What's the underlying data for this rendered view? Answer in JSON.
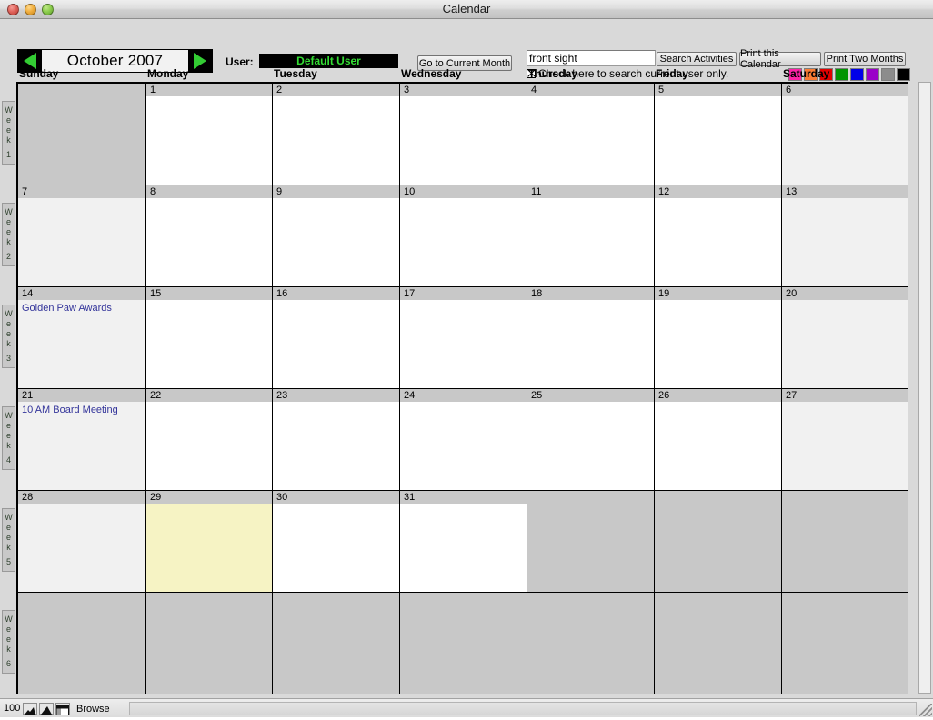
{
  "window": {
    "title": "Calendar",
    "controls": {
      "close": "close-button",
      "minimize": "minimize-button",
      "zoom": "zoom-button"
    }
  },
  "toolbar": {
    "prev_month_icon": "triangle-left-icon",
    "next_month_icon": "triangle-right-icon",
    "month_label": "October 2007",
    "user_label": "User:",
    "user_value": "Default User",
    "goto_current_month": "Go to Current Month",
    "search_value": "front sight",
    "search_placeholder": "",
    "search_activities": "Search Activities",
    "print_this_calendar": "Print this Calendar",
    "print_two_months": "Print Two Months",
    "search_user_only_label": "Check here to search current user only.",
    "search_user_only_checked": true,
    "color_swatches": [
      {
        "name": "magenta",
        "hex": "#ff21a8"
      },
      {
        "name": "orange",
        "hex": "#fa7c34"
      },
      {
        "name": "red",
        "hex": "#e00000"
      },
      {
        "name": "green",
        "hex": "#009400"
      },
      {
        "name": "blue",
        "hex": "#0000e8"
      },
      {
        "name": "purple",
        "hex": "#9a00c8"
      },
      {
        "name": "gray",
        "hex": "#8c8c8c"
      },
      {
        "name": "black",
        "hex": "#000000"
      }
    ]
  },
  "calendar": {
    "day_headers": [
      "Sunday",
      "Monday",
      "Tuesday",
      "Wednesday",
      "Thursday",
      "Friday",
      "Saturday"
    ],
    "week_labels": [
      "Week 1",
      "Week 2",
      "Week 3",
      "Week 4",
      "Week 5",
      "Week 6"
    ],
    "weeks": [
      {
        "label": "Week 1",
        "days": [
          {
            "date": "",
            "blank": true,
            "weekend": true,
            "events": []
          },
          {
            "date": "1",
            "blank": false,
            "weekend": false,
            "events": []
          },
          {
            "date": "2",
            "blank": false,
            "weekend": false,
            "events": []
          },
          {
            "date": "3",
            "blank": false,
            "weekend": false,
            "events": []
          },
          {
            "date": "4",
            "blank": false,
            "weekend": false,
            "events": []
          },
          {
            "date": "5",
            "blank": false,
            "weekend": false,
            "events": []
          },
          {
            "date": "6",
            "blank": false,
            "weekend": true,
            "events": []
          }
        ]
      },
      {
        "label": "Week 2",
        "days": [
          {
            "date": "7",
            "blank": false,
            "weekend": true,
            "events": []
          },
          {
            "date": "8",
            "blank": false,
            "weekend": false,
            "events": []
          },
          {
            "date": "9",
            "blank": false,
            "weekend": false,
            "events": []
          },
          {
            "date": "10",
            "blank": false,
            "weekend": false,
            "events": []
          },
          {
            "date": "11",
            "blank": false,
            "weekend": false,
            "events": []
          },
          {
            "date": "12",
            "blank": false,
            "weekend": false,
            "events": []
          },
          {
            "date": "13",
            "blank": false,
            "weekend": true,
            "events": []
          }
        ]
      },
      {
        "label": "Week 3",
        "days": [
          {
            "date": "14",
            "blank": false,
            "weekend": true,
            "events": [
              "Golden Paw Awards"
            ]
          },
          {
            "date": "15",
            "blank": false,
            "weekend": false,
            "events": []
          },
          {
            "date": "16",
            "blank": false,
            "weekend": false,
            "events": []
          },
          {
            "date": "17",
            "blank": false,
            "weekend": false,
            "events": []
          },
          {
            "date": "18",
            "blank": false,
            "weekend": false,
            "events": []
          },
          {
            "date": "19",
            "blank": false,
            "weekend": false,
            "events": []
          },
          {
            "date": "20",
            "blank": false,
            "weekend": true,
            "events": []
          }
        ]
      },
      {
        "label": "Week 4",
        "days": [
          {
            "date": "21",
            "blank": false,
            "weekend": true,
            "events": [
              "10 AM Board Meeting"
            ]
          },
          {
            "date": "22",
            "blank": false,
            "weekend": false,
            "events": []
          },
          {
            "date": "23",
            "blank": false,
            "weekend": false,
            "events": []
          },
          {
            "date": "24",
            "blank": false,
            "weekend": false,
            "events": []
          },
          {
            "date": "25",
            "blank": false,
            "weekend": false,
            "events": []
          },
          {
            "date": "26",
            "blank": false,
            "weekend": false,
            "events": []
          },
          {
            "date": "27",
            "blank": false,
            "weekend": true,
            "events": []
          }
        ]
      },
      {
        "label": "Week 5",
        "days": [
          {
            "date": "28",
            "blank": false,
            "weekend": true,
            "events": []
          },
          {
            "date": "29",
            "blank": false,
            "weekend": false,
            "selected": true,
            "events": []
          },
          {
            "date": "30",
            "blank": false,
            "weekend": false,
            "events": []
          },
          {
            "date": "31",
            "blank": false,
            "weekend": false,
            "events": []
          },
          {
            "date": "",
            "blank": true,
            "weekend": false,
            "events": []
          },
          {
            "date": "",
            "blank": true,
            "weekend": false,
            "events": []
          },
          {
            "date": "",
            "blank": true,
            "weekend": true,
            "events": []
          }
        ]
      },
      {
        "label": "Week 6",
        "days": [
          {
            "date": "",
            "blank": true,
            "weekend": true,
            "events": []
          },
          {
            "date": "",
            "blank": true,
            "weekend": false,
            "events": []
          },
          {
            "date": "",
            "blank": true,
            "weekend": false,
            "events": []
          },
          {
            "date": "",
            "blank": true,
            "weekend": false,
            "events": []
          },
          {
            "date": "",
            "blank": true,
            "weekend": false,
            "events": []
          },
          {
            "date": "",
            "blank": true,
            "weekend": false,
            "events": []
          },
          {
            "date": "",
            "blank": true,
            "weekend": true,
            "events": []
          }
        ]
      }
    ]
  },
  "statusbar": {
    "zoom_level": "100",
    "zoom_out_icon": "zoom-out-icon",
    "zoom_in_icon": "zoom-in-icon",
    "toggle_window_icon": "toggle-window-icon",
    "mode": "Browse"
  }
}
